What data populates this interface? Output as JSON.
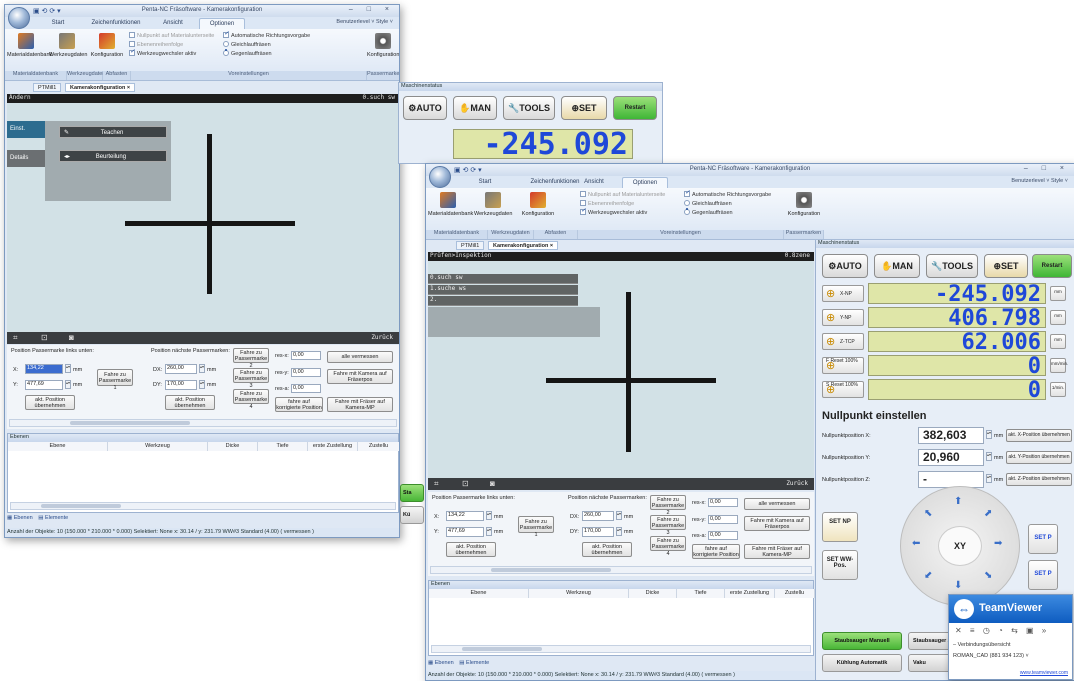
{
  "app": {
    "title": "Penta-NC Fräsoftware - Kamerakonfiguration",
    "user_level": "Benutzerlevel",
    "style": "Style",
    "window_controls": "– □ ×"
  },
  "ribbon": {
    "tabs": [
      "Start",
      "Zeichenfunktionen",
      "Ansicht",
      "Optionen"
    ],
    "buttons": {
      "materialdatenbank": "Materialdatenbank",
      "werkzeugdaten": "Werkzeugdaten",
      "konfiguration": "Konfiguration",
      "konfiguration2": "Konfiguration"
    },
    "options": {
      "nullpunkt": "Nullpunkt auf Materialunterseite",
      "ebenenreihenfolge": "Ebenenreihenfolge",
      "werkzeugwechsler": "Werkzeugwechsler aktiv",
      "auto_richtung": "Automatische Richtungsvorgabe",
      "gleichlauf": "Gleichlauffräsen",
      "gegenlauf": "Gegenlauffräsen"
    },
    "groups": {
      "materialdatenbank": "Materialdatenbank",
      "werkzeugdaten": "Werkzeugdaten",
      "abfasten": "Abfasten",
      "voreinstellungen": "Voreinstellungen",
      "passermarken": "Passermarken"
    }
  },
  "doctabs": {
    "pmill": "PTMill1",
    "kamera": "Kamerakonfiguration"
  },
  "camera": {
    "header_left_1": "Ändern",
    "header_right_1": "0.such sw",
    "header_left_2": "Prüfen>Inspektion",
    "header_right_2": "0.8zene",
    "menu": {
      "einst": "Einst.",
      "details": "Details",
      "teachen": "Teachen",
      "beurteilung": "Beurteilung"
    },
    "overlay_rows": [
      "0.such sw",
      "1.suche ws",
      "2."
    ],
    "zurueck": "Zurück"
  },
  "passermarke": {
    "pos_label": "Position Passermarke links unten:",
    "x_label": "X:",
    "x_value": "134,22",
    "y_label": "Y:",
    "y_value": "477,69",
    "unit": "mm",
    "fahre_zu_1": "Fahre zu Passermarke 1",
    "akt_pos": "akt. Position übernehmen",
    "next_label": "Position nächste Passermarken:",
    "dx_label": "DX:",
    "dx_value": "260,00",
    "dy_label": "DY:",
    "dy_value": "170,00",
    "akt_pos2": "akt. Position übernehmen",
    "fahre_zu_2": "Fahre zu Passermarke 2",
    "fahre_zu_3": "Fahre zu Passermarke 3",
    "fahre_zu_4": "Fahre zu Passermarke 4",
    "res_x_label": "res-x:",
    "res_x": "0,00",
    "res_y_label": "res-y:",
    "res_y": "0,00",
    "res_a_label": "res-a:",
    "res_a": "0,00",
    "alle_vermessen": "alle vermessen",
    "fahre_kamera": "Fahre mit Kamera auf Fräserpos",
    "fahre_korr": "fahre auf korrigierte Position",
    "fahre_fraeser": "Fahre mit Fräser auf Kamera-MP"
  },
  "ebenen": {
    "title": "Ebenen",
    "columns": [
      "Ebene",
      "Werkzeug",
      "Dicke",
      "Tiefe",
      "erste Zustellung",
      "Zustellu"
    ],
    "tab_ebenen": "Ebenen",
    "tab_elemente": "Elemente"
  },
  "statusbar": {
    "text": "Anzahl der Objekte: 10 (150.000 * 210.000 * 0.000)   Selektiert: None    x:   30.14 / y:   231.79    WW#3 Standard (4.00) ( vermessen )"
  },
  "maschinenstatus": {
    "title": "Maschinenstatus",
    "modes": [
      "AUTO",
      "MAN",
      "TOOLS",
      "SET",
      "Restart"
    ],
    "axes": [
      {
        "label": "X-NP",
        "value": "-245.092",
        "unit": "mm"
      },
      {
        "label": "Y-NP",
        "value": "406.798",
        "unit": "mm"
      },
      {
        "label": "Z-TCP",
        "value": "62.006",
        "unit": "mm"
      },
      {
        "label": "F Reset 100%",
        "value": "0",
        "unit": "mm/min."
      },
      {
        "label": "S Reset 100%",
        "value": "0",
        "unit": "1/min."
      }
    ],
    "win1_values": [
      "-245.092",
      "406.798"
    ],
    "nullpunkt_title": "Nullpunkt einstellen",
    "np_x_label": "Nullpunktposition X:",
    "np_x_value": "382,603",
    "np_y_label": "Nullpunktposition Y:",
    "np_y_value": "20,960",
    "np_z_label": "Nullpunktposition Z:",
    "np_z_value": "-",
    "akt_x": "akt. X-Position übernehmen",
    "akt_y": "akt. Y-Position übernehmen",
    "akt_z": "akt. Z-Position übernehmen",
    "set_np": "SET NP",
    "set_ww": "SET WW-Pos.",
    "xy": "XY",
    "set_p": "SET P",
    "staubsauger_manuell": "Staubsauger Manuell",
    "staubsauger_auto": "Staubsauger A",
    "kuehlung": "Kühlung Automatik",
    "vakuum": "Vaku",
    "start": "Sta",
    "kuehl_short": "Kü"
  },
  "teamviewer": {
    "brand": "TeamViewer",
    "verbindung": "Verbindungsübersicht",
    "entry": "ROMAN_CAD (881 934 123)",
    "link": "www.teamviewer.com"
  }
}
